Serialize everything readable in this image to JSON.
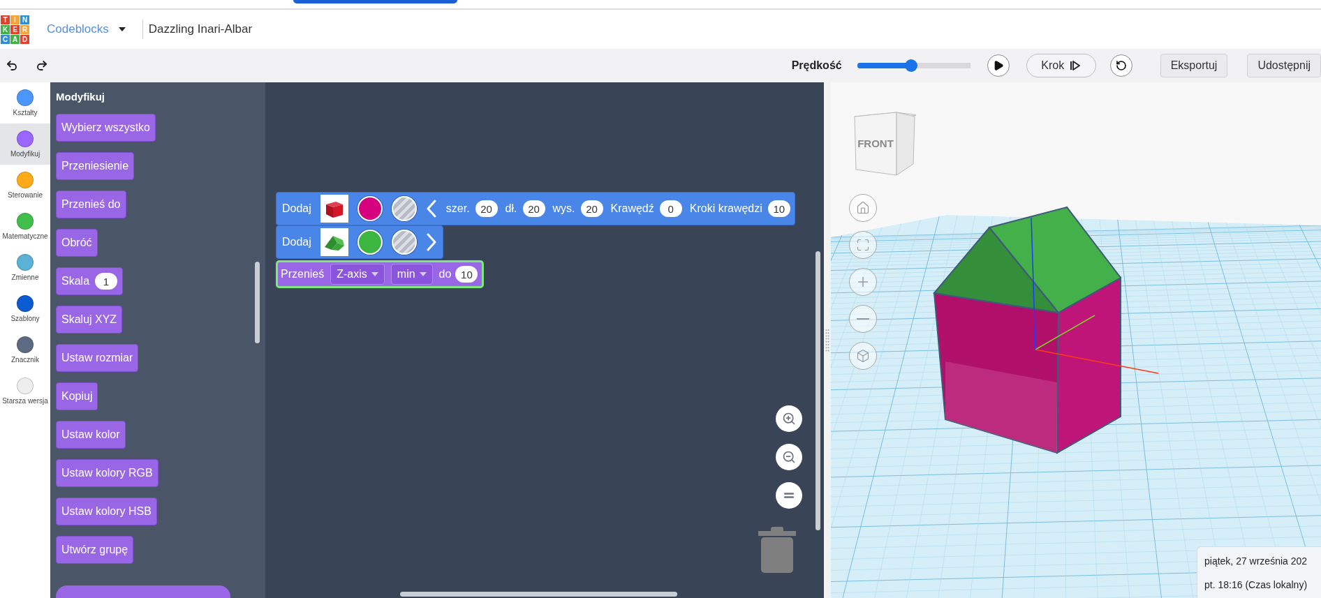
{
  "header": {
    "logo_letters": [
      "T",
      "I",
      "N",
      "K",
      "E",
      "R",
      "C",
      "A",
      "D"
    ],
    "mode": "Codeblocks",
    "design_name": "Dazzling Inari-Albar"
  },
  "toolbar": {
    "speed_label": "Prędkość",
    "speed": {
      "level": 0.48
    },
    "step_button": "Krok",
    "buttons": [
      "Eksportuj",
      "Udostępnij"
    ]
  },
  "categories": [
    {
      "label": "Kształty",
      "color": "#4c97ff",
      "selected": false
    },
    {
      "label": "Modyfikuj",
      "color": "#9966ff",
      "selected": true
    },
    {
      "label": "Sterowanie",
      "color": "#ffab19",
      "selected": false
    },
    {
      "label": "Matematyczne",
      "color": "#40bf4a",
      "selected": false
    },
    {
      "label": "Zmienne",
      "color": "#5cb1d6",
      "selected": false
    },
    {
      "label": "Szablony",
      "color": "#0b5bd1",
      "selected": false
    },
    {
      "label": "Znacznik",
      "color": "#5c6b82",
      "selected": false
    },
    {
      "label": "Starsza wersja",
      "color": "#eeeeee",
      "selected": false
    }
  ],
  "palette": {
    "title": "Modyfikuj",
    "blocks": [
      {
        "label": "Wybierz wszystko"
      },
      {
        "label": "Przeniesienie"
      },
      {
        "label": "Przenieś do"
      },
      {
        "label": "Obróć"
      },
      {
        "label": "Skala",
        "value": "1"
      },
      {
        "label": "Skaluj XYZ"
      },
      {
        "label": "Ustaw rozmiar"
      },
      {
        "label": "Kopiuj"
      },
      {
        "label": "Ustaw kolor"
      },
      {
        "label": "Ustaw kolory RGB"
      },
      {
        "label": "Ustaw kolory HSB"
      },
      {
        "label": "Utwórz grupę"
      }
    ]
  },
  "workspace": {
    "blocks": [
      {
        "kind": "add",
        "label": "Dodaj",
        "thumbnail": {
          "kind": "box"
        },
        "color": "#d6007f",
        "expanded": true,
        "params": [
          {
            "label": "szer.",
            "value": "20"
          },
          {
            "label": "dł.",
            "value": "20"
          },
          {
            "label": "wys.",
            "value": "20"
          },
          {
            "label": "Krawędź",
            "value": "0"
          },
          {
            "label": "Kroki krawędzi",
            "value": "10"
          }
        ]
      },
      {
        "kind": "add",
        "label": "Dodaj",
        "thumbnail": {
          "kind": "roof"
        },
        "color": "#3db541",
        "expanded": false
      },
      {
        "kind": "move",
        "label": "Przenieś",
        "selected": true,
        "dropdowns": [
          "Z-axis",
          "min"
        ],
        "to_label": "do",
        "value": "10"
      }
    ]
  },
  "viewport": {
    "view_cube_label": "FRONT"
  },
  "tooltip": {
    "date": "piątek, 27 września 202",
    "time": "pt. 18:16 (Czas lokalny)"
  }
}
